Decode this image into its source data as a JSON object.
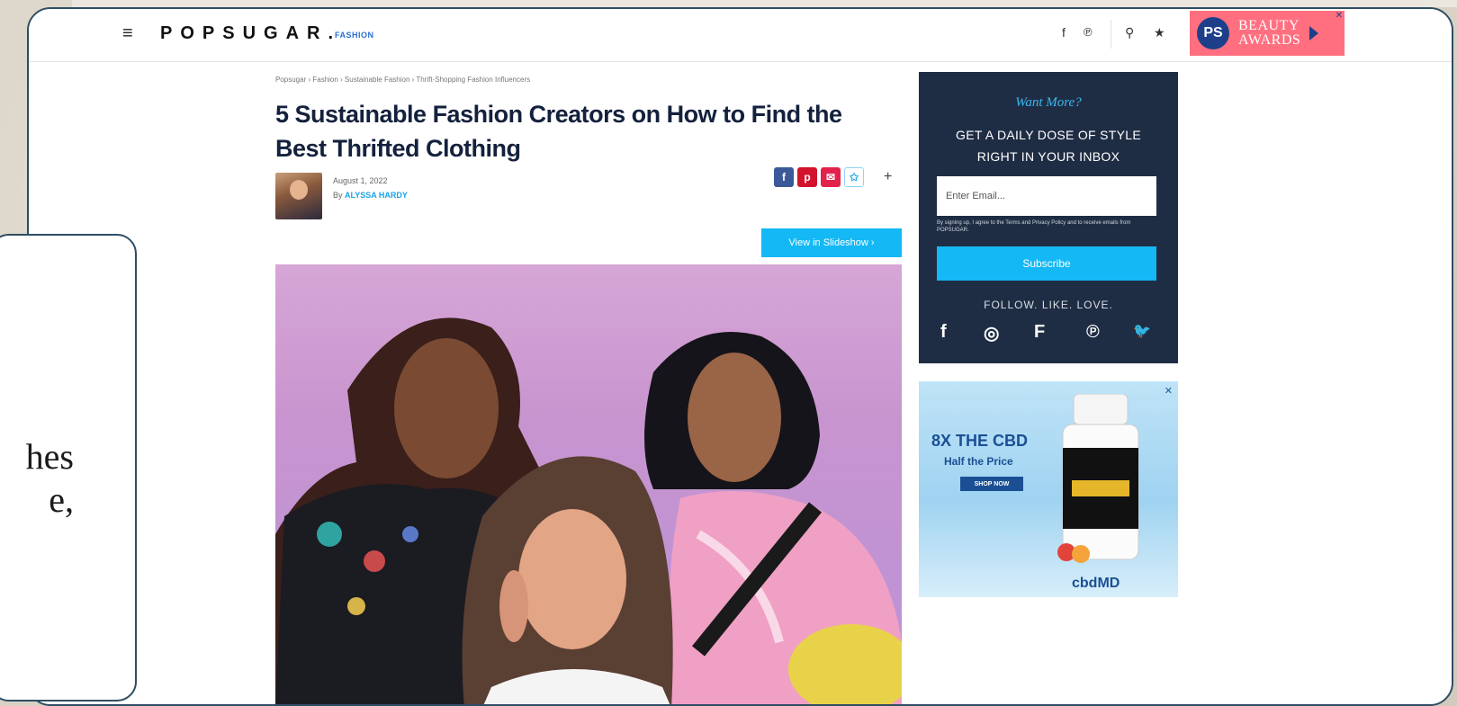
{
  "header": {
    "menu_glyph": "≡",
    "logo": "POPSUGAR.",
    "logo_section": "FASHION",
    "icons": [
      "facebook-icon",
      "pinterest-icon",
      "search-icon",
      "star-icon"
    ],
    "facebook_glyph": "f",
    "pinterest_glyph": "℗",
    "search_glyph": "⚲",
    "star_glyph": "★",
    "banner": {
      "badge": "PS",
      "line1": "BEAUTY",
      "line2": "AWARDS",
      "close_glyph": "✕",
      "color": "#ff6f7f"
    }
  },
  "article": {
    "breadcrumb": "Popsugar › Fashion › Sustainable Fashion › Thrift-Shopping Fashion Influencers",
    "title": "5 Sustainable Fashion Creators on How to Find the Best Thrifted Clothing",
    "date": "August 1, 2022",
    "by_label": "By",
    "author": "ALYSSA HARDY",
    "share_glyphs": [
      "f",
      "p",
      "✉",
      "✩"
    ],
    "share_more": "+",
    "slideshow_label": "View in Slideshow  ›",
    "accent": "#14b8f4"
  },
  "newsletter": {
    "kicker": "Want More?",
    "headline_line1": "GET A DAILY DOSE OF STYLE",
    "headline_line2": "RIGHT IN YOUR INBOX",
    "email_placeholder": "Enter Email...",
    "fine_print": "By signing up, I agree to the Terms and Privacy Policy and to receive emails from POPSUGAR.",
    "subscribe": "Subscribe",
    "follow": "FOLLOW. LIKE. LOVE.",
    "social_glyphs": [
      "f",
      "◎",
      "F",
      "℗",
      "🐦"
    ]
  },
  "ad": {
    "headline": "8X THE CBD",
    "subline": "Half the Price",
    "cta": "SHOP NOW",
    "brand": "cbdMD",
    "close_glyph": "✕"
  },
  "overlay": {
    "line1": "hes",
    "line2": "e,"
  }
}
